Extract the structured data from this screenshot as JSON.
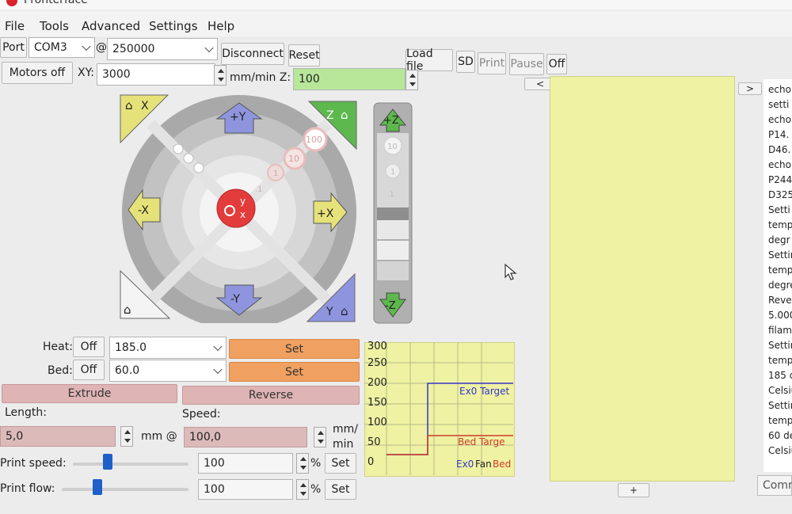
{
  "window": {
    "title": "Pronterface"
  },
  "menu": [
    "File",
    "Tools",
    "Advanced",
    "Settings",
    "Help"
  ],
  "connection": {
    "port_label": "Port",
    "port_value": "COM3",
    "at": "@",
    "baud_value": "250000",
    "disconnect_label": "Disconnect",
    "reset_label": "Reset"
  },
  "file_controls": {
    "load_file_label": "Load file",
    "sd_label": "SD",
    "print_label": "Print",
    "pause_label": "Pause",
    "off_label": "Off"
  },
  "motion": {
    "motors_off_label": "Motors off",
    "xy_label": "XY:",
    "xy_value": "3000",
    "mm_min_z_label": "mm/min Z:",
    "z_value": "100"
  },
  "jog": {
    "home_x": "X",
    "home_z": "Z",
    "home_y": "Y",
    "plus_y": "+Y",
    "minus_y": "-Y",
    "plus_x": "+X",
    "minus_x": "-X",
    "plus_z": "+Z",
    "minus_z": "-Z",
    "step_100": "100",
    "step_10": "10",
    "step_1": "1",
    "step_01": ".1",
    "center_y": "y",
    "center_x": "x"
  },
  "temperature": {
    "heat_label": "Heat:",
    "heat_off": "Off",
    "heat_value": "185.0",
    "heat_set": "Set",
    "bed_label": "Bed:",
    "bed_off": "Off",
    "bed_value": "60.0",
    "bed_set": "Set"
  },
  "extrusion": {
    "extrude_label": "Extrude",
    "reverse_label": "Reverse",
    "length_label": "Length:",
    "length_value": "5,0",
    "mm_at": "mm @",
    "speed_label": "Speed:",
    "speed_value": "100,0",
    "speed_unit_1": "mm/",
    "speed_unit_2": "min"
  },
  "print_speed": {
    "label": "Print speed:",
    "value": "100",
    "percent": "%",
    "set": "Set",
    "slider_fraction": 0.3
  },
  "print_flow": {
    "label": "Print flow:",
    "value": "100",
    "percent": "%",
    "set": "Set",
    "slider_fraction": 0.28
  },
  "graph": {
    "ticks": [
      "300",
      "250",
      "200",
      "150",
      "100",
      "50",
      "0"
    ],
    "ex0_target_label": "Ex0 Target",
    "bed_target_label": "Bed Targe",
    "legend_ex0": "Ex0",
    "legend_fan": "Fan",
    "legend_bed": "Bed",
    "colors": {
      "ex0": "#3535c8",
      "bed": "#d23a2a",
      "background": "#eef2a2"
    }
  },
  "nav": {
    "left_arrow": "<",
    "right_arrow": ">",
    "plus": "+"
  },
  "log": {
    "lines": [
      "echo",
      "setti",
      "echo",
      "P14.",
      "D46.",
      "echo",
      "P244",
      "D325",
      "Setti",
      "temp",
      "degr",
      "Settir",
      "temp",
      "degre",
      "Rever",
      "5.000",
      "filame",
      "Settin",
      "tempe",
      "185 de",
      "Celsiu",
      "Settin",
      "tempe",
      "60 deg",
      "Celsius"
    ],
    "command_label": "Comn"
  }
}
